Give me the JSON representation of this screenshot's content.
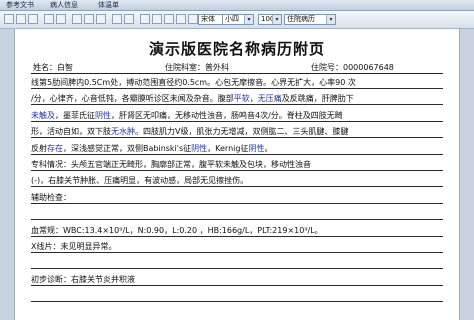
{
  "tabs": [
    "参考文书",
    "病人信息",
    "体温单"
  ],
  "toolbar": {
    "font_name": "宋体",
    "font_size": "小四",
    "zoom": "100%",
    "doc_title": "住院病历"
  },
  "document": {
    "title": "演示版医院名称病历附页",
    "name": "姓名：白智",
    "dept": "住院科室：普外科",
    "inpatient_no": "住院号：0000067648"
  },
  "body_lines": [
    [
      [
        "n",
        "线第5肋间脾内0.5Cm处，搏动范围直径约0.5cm。心包无摩擦音。心界无扩大，心率90 次"
      ]
    ],
    [
      [
        "n",
        "/分，心律齐，心音低钝，各瓣膜听诊区未闻及杂音。腹部"
      ],
      [
        "h",
        "平软"
      ],
      [
        "n",
        "，"
      ],
      [
        "h",
        "无压痛"
      ],
      [
        "n",
        "及反跳痛，肝脾肋下"
      ]
    ],
    [
      [
        "h",
        "未触及"
      ],
      [
        "n",
        "，墨菲氏征"
      ],
      [
        "h",
        "阴性"
      ],
      [
        "n",
        "，肝肾区无叩痛，无移动性浊音，肠鸣音4次/分。脊柱及四肢无畸"
      ]
    ],
    [
      [
        "n",
        "形，活动自如，双下肢"
      ],
      [
        "h",
        "无水肿"
      ],
      [
        "n",
        "。四肢肌力V级，肌张力无增减，双侧肱二、三头肌腱、膝腱"
      ]
    ],
    [
      [
        "n",
        "反射"
      ],
      [
        "h",
        "存在"
      ],
      [
        "n",
        "，深浅感觉正常，双侧Babinski's征"
      ],
      [
        "h",
        "阴性"
      ],
      [
        "n",
        "，Kernig征"
      ],
      [
        "h",
        "阴性"
      ],
      [
        "n",
        "。"
      ]
    ],
    [
      [
        "n",
        "    专科情况：头颅五官端正无畸形，胸廓部正常，腹平软未触及包块，移动性浊音"
      ]
    ],
    [
      [
        "n",
        "(-)，右膝关节肿胀、压痛明显，有波动感，局部无见擦挫伤。"
      ]
    ],
    [
      [
        "n",
        "    辅助检查："
      ]
    ],
    [
      [
        "n",
        ""
      ]
    ],
    [
      [
        "n",
        "    血常规：WBC:13.4×10⁹/L，N:0.90，L:0.20 ，HB:166g/L，PLT:219×10⁹/L。"
      ]
    ],
    [
      [
        "n",
        "    X线片：未见明显异常。"
      ]
    ],
    [
      [
        "n",
        ""
      ]
    ],
    [
      [
        "n",
        "                                                            初步诊断：右膝关节炎并积液"
      ]
    ],
    [
      [
        "n",
        ""
      ]
    ]
  ]
}
